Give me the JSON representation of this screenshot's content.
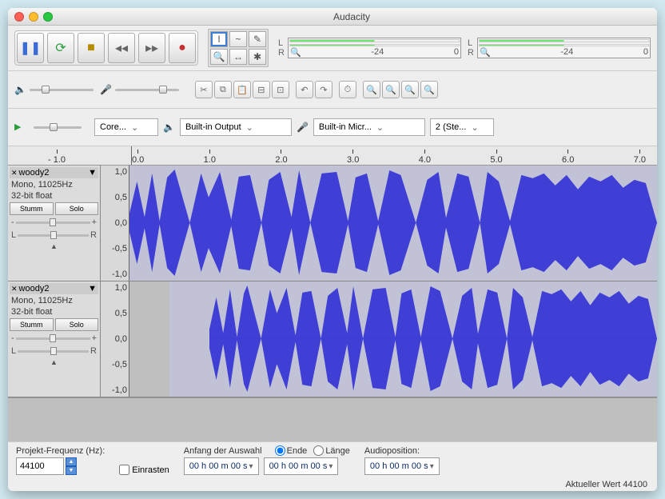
{
  "title": "Audacity",
  "transport": {
    "pause": "❚❚",
    "play": "⟳",
    "stop": "■",
    "skip_start": "◂◂",
    "skip_end": "▸▸",
    "record": "●"
  },
  "tools": [
    "I",
    "~",
    "✎",
    "🔍",
    "↔",
    "✱"
  ],
  "meters": {
    "scale": [
      "-24",
      "0"
    ]
  },
  "devices": {
    "host": "Core...",
    "output": "Built-in Output",
    "input": "Built-in Micr...",
    "channels": "2 (Ste..."
  },
  "ruler": {
    "neg": "- 1.0",
    "pos": [
      "0.0",
      "1.0",
      "2.0",
      "3.0",
      "4.0",
      "5.0",
      "6.0",
      "7.0"
    ]
  },
  "tracks": [
    {
      "name": "woody2",
      "info1": "Mono, 11025Hz",
      "info2": "32-bit float",
      "mute": "Stumm",
      "solo": "Solo",
      "scale": [
        "1,0",
        "0,5",
        "0,0",
        "-0,5",
        "-1,0"
      ]
    },
    {
      "name": "woody2",
      "info1": "Mono, 11025Hz",
      "info2": "32-bit float",
      "mute": "Stumm",
      "solo": "Solo",
      "scale": [
        "1,0",
        "0,5",
        "0,0",
        "-0,5",
        "-1,0"
      ]
    }
  ],
  "footer": {
    "rate_label": "Projekt-Frequenz (Hz):",
    "rate_value": "44100",
    "snap": "Einrasten",
    "sel_start_label": "Anfang der Auswahl",
    "sel_end": "Ende",
    "sel_len": "Länge",
    "audiopos_label": "Audioposition:",
    "time": "00 h 00 m 00 s"
  },
  "status": "Aktueller Wert 44100"
}
